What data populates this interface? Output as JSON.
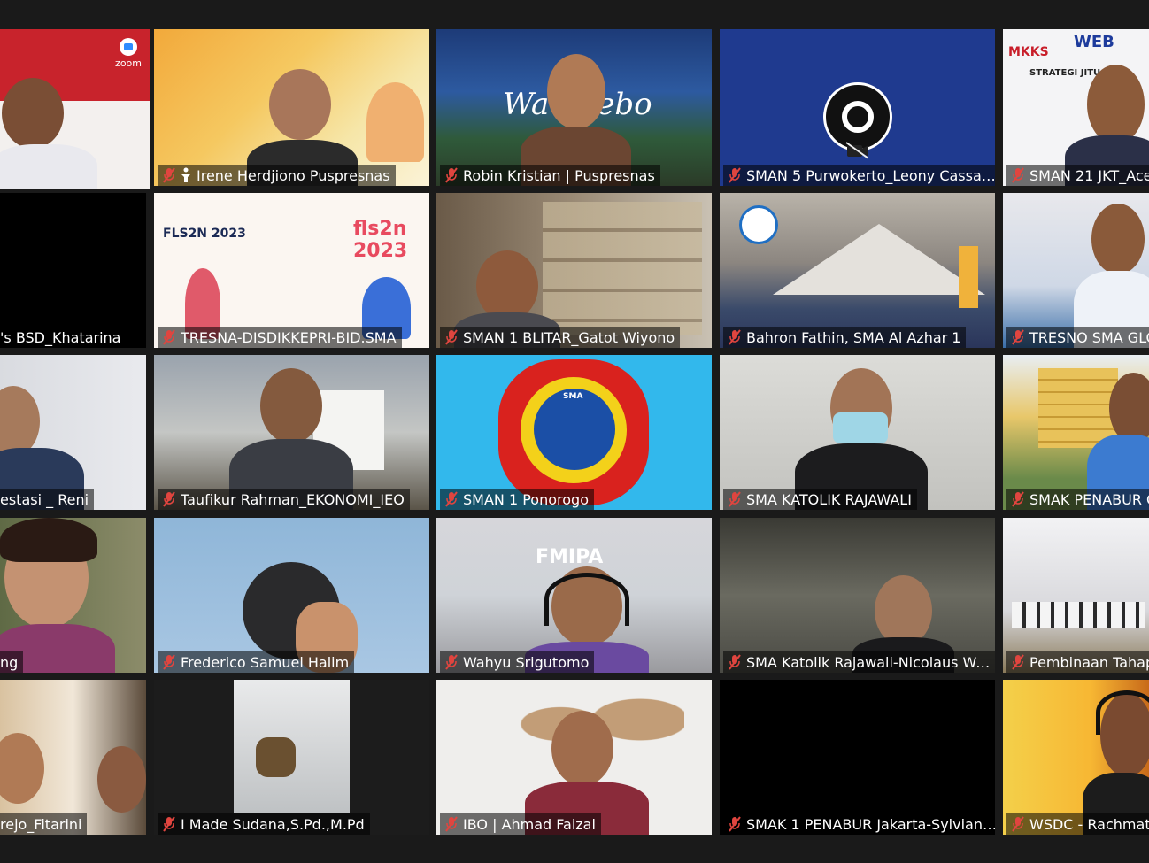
{
  "theme": {
    "background": "#1a1a1a",
    "active_speaker_border": "#e6e84a",
    "muted_icon_color": "#e0453f"
  },
  "app": {
    "name": "zoom"
  },
  "participants": [
    {
      "name": "",
      "muted": false,
      "active_speaker": true
    },
    {
      "name": "Irene Herdjiono Puspresnas",
      "muted": true,
      "spotlight": true
    },
    {
      "name": "Robin Kristian | Puspresnas",
      "muted": true
    },
    {
      "name": "SMAN 5 Purwokerto_Leony Cassan...",
      "muted": true,
      "camera_off": true
    },
    {
      "name": "SMAN 21 JKT_Ace",
      "muted": true
    },
    {
      "name": "'s BSD_Khatarina",
      "muted": false
    },
    {
      "name": "TRESNA-DISDIKKEPRI-BID.SMA",
      "muted": true
    },
    {
      "name": "SMAN 1 BLITAR_Gatot Wiyono",
      "muted": true
    },
    {
      "name": "Bahron Fathin, SMA Al Azhar 1",
      "muted": true
    },
    {
      "name": "TRESNO SMA GLO",
      "muted": true
    },
    {
      "name": "estasi _ Reni",
      "muted": false
    },
    {
      "name": "Taufikur Rahman_EKONOMI_IEO",
      "muted": true
    },
    {
      "name": "SMAN 1 Ponorogo",
      "muted": true
    },
    {
      "name": "SMA KATOLIK RAJAWALI",
      "muted": true
    },
    {
      "name": "SMAK PENABUR C",
      "muted": true
    },
    {
      "name": "ng",
      "muted": false
    },
    {
      "name": "Frederico Samuel Halim",
      "muted": true
    },
    {
      "name": "Wahyu Srigutomo",
      "muted": true
    },
    {
      "name": "SMA Katolik Rajawali-Nicolaus Wa...",
      "muted": true
    },
    {
      "name": "Pembinaan Tahap",
      "muted": true
    },
    {
      "name": "rejo_Fitarini",
      "muted": false
    },
    {
      "name": "I Made Sudana,S.Pd.,M.Pd",
      "muted": true
    },
    {
      "name": "IBO | Ahmad Faizal",
      "muted": true
    },
    {
      "name": "SMAK 1 PENABUR Jakarta-Sylviana...",
      "muted": true
    },
    {
      "name": "WSDC - Rachmat",
      "muted": true
    }
  ],
  "overlays": {
    "tile2_text": "Wa     ebo",
    "tile4_text1": "WEB",
    "tile4_text2": "MKKS",
    "tile4_text3": "STRATEGI JITU F",
    "tile6_text1": "FLS2N 2023",
    "tile6_text2": "fls2n 2023",
    "tile12_text": "SMA",
    "tile17_text": "FMIPA"
  }
}
